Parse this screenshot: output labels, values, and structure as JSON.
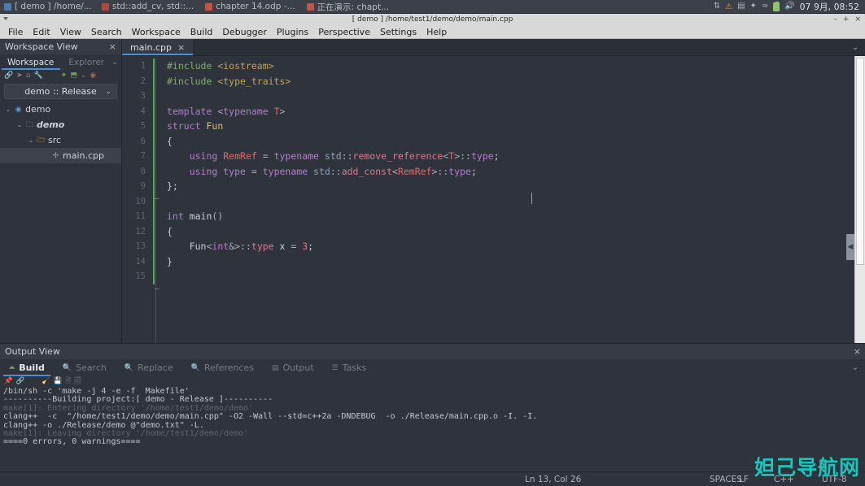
{
  "taskbar": {
    "items": [
      {
        "label": "[ demo ] /home/...",
        "icon": "window-icon"
      },
      {
        "label": "std::add_cv, std::...",
        "icon": "browser-icon"
      },
      {
        "label": "chapter 14.odp -...",
        "icon": "presentation-icon"
      },
      {
        "label": "正在演示: chapt...",
        "icon": "presentation-icon"
      }
    ],
    "tray": {
      "network_icon": "network-icon",
      "warning_icon": "warning-icon",
      "keyboard_icon": "keyboard-icon",
      "bluetooth_icon": "bluetooth-icon",
      "wifi_icon": "wifi-icon",
      "battery_icon": "battery-icon",
      "volume_icon": "volume-icon",
      "clock": "07 9月, 08:52"
    }
  },
  "window": {
    "title": "[ demo ] /home/test1/demo/demo/main.cpp",
    "minimize": "–",
    "maximize": "+",
    "close": "×"
  },
  "menubar": {
    "items": [
      "File",
      "Edit",
      "View",
      "Search",
      "Workspace",
      "Build",
      "Debugger",
      "Plugins",
      "Perspective",
      "Settings",
      "Help"
    ]
  },
  "workspace_view": {
    "title": "Workspace View",
    "close": "×",
    "tabs": [
      {
        "label": "Workspace",
        "active": true
      },
      {
        "label": "Explorer",
        "active": false
      }
    ],
    "overflow_chevron": "⌄",
    "toolbar_icons": [
      "link-icon",
      "send-icon",
      "home-icon",
      "wrench-icon",
      "run-icon",
      "build-icon",
      "chevron-down-icon",
      "stop-icon"
    ],
    "config_selector": {
      "value": "demo :: Release",
      "chevron": "⌄"
    },
    "tree": [
      {
        "label": "demo",
        "icon": "workspace-icon",
        "twisty": "⌄",
        "indent": 1,
        "style": "normal",
        "selected": false
      },
      {
        "label": "demo",
        "icon": "folder-icon",
        "twisty": "⌄",
        "indent": 2,
        "style": "bold-italic",
        "selected": false
      },
      {
        "label": "src",
        "icon": "folder-open-icon",
        "twisty": "⌄",
        "indent": 3,
        "style": "normal",
        "selected": false
      },
      {
        "label": "main.cpp",
        "icon": "cpp-file-icon",
        "twisty": "",
        "indent": 4,
        "style": "normal",
        "selected": true
      }
    ]
  },
  "editor": {
    "tabs": [
      {
        "label": "main.cpp",
        "close": "×",
        "active": true
      }
    ],
    "overflow_chevron": "⌄",
    "line_numbers": [
      "1",
      "2",
      "3",
      "4",
      "5",
      "6",
      "7",
      "8",
      "9",
      "10",
      "11",
      "12",
      "13",
      "14",
      "15"
    ],
    "fold_markers": {
      "6": "–",
      "12": "–"
    },
    "code_lines": [
      {
        "n": 1,
        "tokens": [
          {
            "t": "#include ",
            "c": "s-pre"
          },
          {
            "t": "<iostream>",
            "c": "s-str"
          }
        ]
      },
      {
        "n": 2,
        "tokens": [
          {
            "t": "#include ",
            "c": "s-pre"
          },
          {
            "t": "<type_traits>",
            "c": "s-str"
          }
        ]
      },
      {
        "n": 3,
        "tokens": []
      },
      {
        "n": 4,
        "tokens": [
          {
            "t": "template ",
            "c": "s-kw"
          },
          {
            "t": "<",
            "c": "s-op"
          },
          {
            "t": "typename ",
            "c": "s-kw"
          },
          {
            "t": "T",
            "c": "s-type"
          },
          {
            "t": ">",
            "c": "s-op"
          }
        ]
      },
      {
        "n": 5,
        "tokens": [
          {
            "t": "struct ",
            "c": "s-kw"
          },
          {
            "t": "Fun",
            "c": "s-fn"
          }
        ]
      },
      {
        "n": 6,
        "tokens": [
          {
            "t": "{",
            "c": "s-plain"
          }
        ]
      },
      {
        "n": 7,
        "tokens": [
          {
            "t": "    using ",
            "c": "s-kw"
          },
          {
            "t": "RemRef",
            "c": "s-type"
          },
          {
            "t": " = ",
            "c": "s-op"
          },
          {
            "t": "typename ",
            "c": "s-kw"
          },
          {
            "t": "std",
            "c": "s-ns"
          },
          {
            "t": "::",
            "c": "s-op"
          },
          {
            "t": "remove_reference",
            "c": "s-meth"
          },
          {
            "t": "<",
            "c": "s-op"
          },
          {
            "t": "T",
            "c": "s-type"
          },
          {
            "t": ">::",
            "c": "s-op"
          },
          {
            "t": "type",
            "c": "s-kw"
          },
          {
            "t": ";",
            "c": "s-plain"
          }
        ]
      },
      {
        "n": 8,
        "tokens": [
          {
            "t": "    using ",
            "c": "s-kw"
          },
          {
            "t": "type",
            "c": "s-kw"
          },
          {
            "t": " = ",
            "c": "s-op"
          },
          {
            "t": "typename ",
            "c": "s-kw"
          },
          {
            "t": "std",
            "c": "s-ns"
          },
          {
            "t": "::",
            "c": "s-op"
          },
          {
            "t": "add_const",
            "c": "s-meth"
          },
          {
            "t": "<",
            "c": "s-op"
          },
          {
            "t": "RemRef",
            "c": "s-type"
          },
          {
            "t": ">::",
            "c": "s-op"
          },
          {
            "t": "type",
            "c": "s-kw"
          },
          {
            "t": ";",
            "c": "s-plain"
          }
        ]
      },
      {
        "n": 9,
        "tokens": [
          {
            "t": "};",
            "c": "s-plain"
          }
        ]
      },
      {
        "n": 10,
        "tokens": []
      },
      {
        "n": 11,
        "tokens": [
          {
            "t": "int ",
            "c": "s-kw"
          },
          {
            "t": "main",
            "c": "s-plain"
          },
          {
            "t": "()",
            "c": "s-op"
          }
        ]
      },
      {
        "n": 12,
        "tokens": [
          {
            "t": "{",
            "c": "s-plain"
          }
        ]
      },
      {
        "n": 13,
        "tokens": [
          {
            "t": "    Fun",
            "c": "s-plain"
          },
          {
            "t": "<",
            "c": "s-op"
          },
          {
            "t": "int",
            "c": "s-kw"
          },
          {
            "t": "&>::",
            "c": "s-op"
          },
          {
            "t": "type",
            "c": "s-meth"
          },
          {
            "t": " x ",
            "c": "s-plain"
          },
          {
            "t": "= ",
            "c": "s-op"
          },
          {
            "t": "3",
            "c": "s-num"
          },
          {
            "t": ";",
            "c": "s-plain"
          }
        ]
      },
      {
        "n": 14,
        "tokens": [
          {
            "t": "}",
            "c": "s-plain"
          }
        ]
      },
      {
        "n": 15,
        "tokens": []
      }
    ]
  },
  "output_view": {
    "title": "Output View",
    "close": "×",
    "tabs": [
      {
        "label": "Build",
        "icon": "build-icon",
        "active": true
      },
      {
        "label": "Search",
        "icon": "search-icon",
        "active": false
      },
      {
        "label": "Replace",
        "icon": "replace-icon",
        "active": false
      },
      {
        "label": "References",
        "icon": "references-icon",
        "active": false
      },
      {
        "label": "Output",
        "icon": "output-icon",
        "active": false
      },
      {
        "label": "Tasks",
        "icon": "tasks-icon",
        "active": false
      }
    ],
    "overflow_chevron": "⌄",
    "toolbar_icons": [
      "pin-icon",
      "link-icon",
      "clear-icon",
      "save-icon",
      "copy-icon",
      "copy-all-icon"
    ],
    "log_lines": [
      {
        "text": "/bin/sh -c 'make -j 4 -e -f  Makefile'",
        "dim": false
      },
      {
        "text": "----------Building project:[ demo - Release ]----------",
        "dim": false
      },
      {
        "text": "make[1]: Entering directory '/home/test1/demo/demo'",
        "dim": true
      },
      {
        "text": "clang++  -c  \"/home/test1/demo/demo/main.cpp\" -O2 -Wall --std=c++2a -DNDEBUG  -o ./Release/main.cpp.o -I. -I.",
        "dim": false
      },
      {
        "text": "clang++ -o ./Release/demo @\"demo.txt\" -L.",
        "dim": false
      },
      {
        "text": "make[1]: Leaving directory '/home/test1/demo/demo'",
        "dim": true
      },
      {
        "text": "====0 errors, 0 warnings====",
        "dim": false
      }
    ]
  },
  "statusbar": {
    "position": "Ln 13, Col 26",
    "indent": "SPACES",
    "line_ending": "LF",
    "language": "C++",
    "encoding": "UTF-8"
  },
  "watermark": {
    "text": "妲己导航网"
  },
  "colors": {
    "accent": "#4a90d9",
    "panel_bg": "#2f333b",
    "editor_bg": "#2f343c",
    "titlebar_bg": "#d8d8d8",
    "watermark": "#17c8c0",
    "fold_bar_green": "#4caf50"
  }
}
